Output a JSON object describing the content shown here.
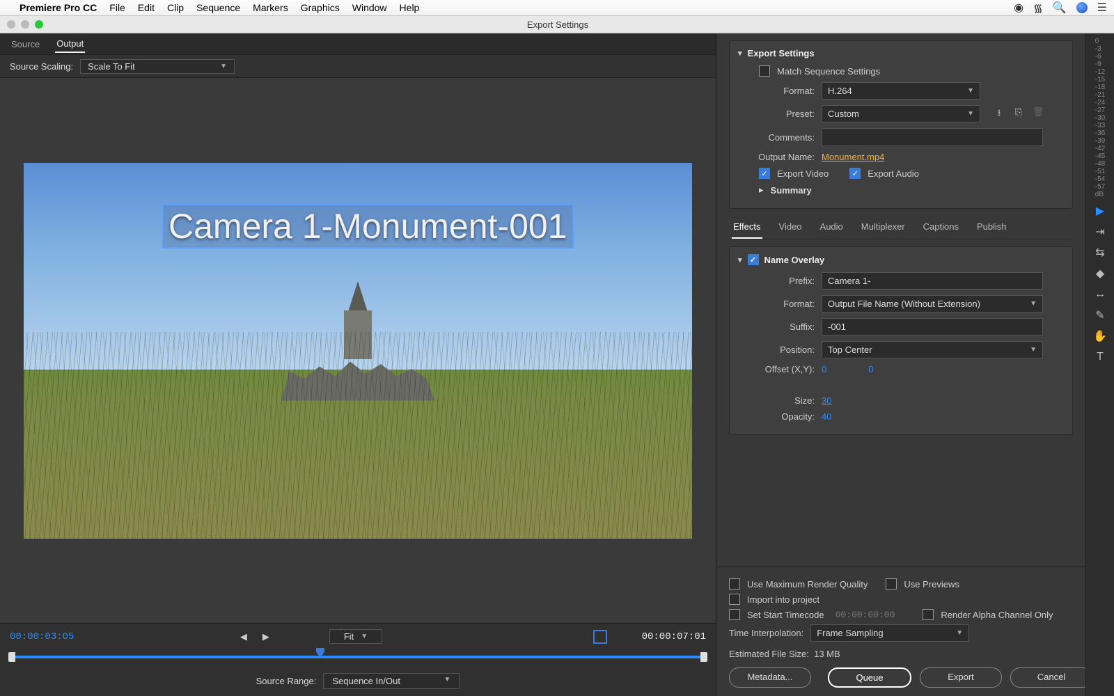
{
  "menubar": {
    "app": "Premiere Pro CC",
    "items": [
      "File",
      "Edit",
      "Clip",
      "Sequence",
      "Markers",
      "Graphics",
      "Window",
      "Help"
    ]
  },
  "window": {
    "title": "Export Settings"
  },
  "left": {
    "tabs": {
      "source": "Source",
      "output": "Output",
      "active": "output"
    },
    "scaling_label": "Source Scaling:",
    "scaling_value": "Scale To Fit",
    "overlay_text": "Camera 1-Monument-001",
    "tc_in": "00:00:03:05",
    "tc_out": "00:00:07:01",
    "fit_label": "Fit",
    "source_range_label": "Source Range:",
    "source_range_value": "Sequence In/Out"
  },
  "export_settings": {
    "header": "Export Settings",
    "match_seq_label": "Match Sequence Settings",
    "match_seq_checked": false,
    "format_label": "Format:",
    "format_value": "H.264",
    "preset_label": "Preset:",
    "preset_value": "Custom",
    "comments_label": "Comments:",
    "comments_value": "",
    "output_name_label": "Output Name:",
    "output_name_value": "Monument.mp4",
    "export_video_label": "Export Video",
    "export_video_checked": true,
    "export_audio_label": "Export Audio",
    "export_audio_checked": true,
    "summary_label": "Summary"
  },
  "eff_tabs": [
    "Effects",
    "Video",
    "Audio",
    "Multiplexer",
    "Captions",
    "Publish"
  ],
  "name_overlay": {
    "header": "Name Overlay",
    "checked": true,
    "prefix_label": "Prefix:",
    "prefix_value": "Camera 1-",
    "format_label": "Format:",
    "format_value": "Output File Name (Without Extension)",
    "suffix_label": "Suffix:",
    "suffix_value": "-001",
    "position_label": "Position:",
    "position_value": "Top Center",
    "offset_label": "Offset (X,Y):",
    "offset_x": "0",
    "offset_y": "0",
    "size_label": "Size:",
    "size_value": "30",
    "opacity_label": "Opacity:",
    "opacity_value": "40"
  },
  "bottom": {
    "use_max_render": "Use Maximum Render Quality",
    "use_previews": "Use Previews",
    "import_project": "Import into project",
    "set_start_tc": "Set Start Timecode",
    "start_tc_value": "00:00:00:00",
    "render_alpha": "Render Alpha Channel Only",
    "time_interp_label": "Time Interpolation:",
    "time_interp_value": "Frame Sampling",
    "est_label": "Estimated File Size:",
    "est_value": "13 MB",
    "btn_metadata": "Metadata...",
    "btn_queue": "Queue",
    "btn_export": "Export",
    "btn_cancel": "Cancel"
  },
  "scale_ticks": [
    "0",
    "-3",
    "-6",
    "-9",
    "-12",
    "-15",
    "-18",
    "-21",
    "-24",
    "-27",
    "-30",
    "-33",
    "-36",
    "-39",
    "-42",
    "-45",
    "-48",
    "-51",
    "-54",
    "-57",
    "dB"
  ]
}
